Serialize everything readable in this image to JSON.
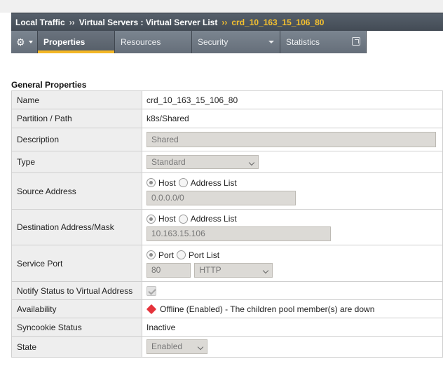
{
  "breadcrumb": {
    "section": "Local Traffic",
    "sep1": "››",
    "path": "Virtual Servers : Virtual Server List",
    "sep2": "››",
    "current": "crd_10_163_15_106_80"
  },
  "tabs": [
    {
      "label": "Properties"
    },
    {
      "label": "Resources"
    },
    {
      "label": "Security"
    },
    {
      "label": "Statistics"
    }
  ],
  "section_title": "General Properties",
  "props": {
    "name": {
      "label": "Name",
      "value": "crd_10_163_15_106_80"
    },
    "partition": {
      "label": "Partition / Path",
      "value": "k8s/Shared"
    },
    "description": {
      "label": "Description",
      "value": "Shared"
    },
    "type": {
      "label": "Type",
      "value": "Standard"
    },
    "source": {
      "label": "Source Address",
      "opt1": "Host",
      "opt2": "Address List",
      "value": "0.0.0.0/0"
    },
    "destination": {
      "label": "Destination Address/Mask",
      "opt1": "Host",
      "opt2": "Address List",
      "value": "10.163.15.106"
    },
    "service_port": {
      "label": "Service Port",
      "opt1": "Port",
      "opt2": "Port List",
      "port": "80",
      "protocol": "HTTP"
    },
    "notify": {
      "label": "Notify Status to Virtual Address"
    },
    "availability": {
      "label": "Availability",
      "value": "Offline (Enabled) - The children pool member(s) are down"
    },
    "syncookie": {
      "label": "Syncookie Status",
      "value": "Inactive"
    },
    "state": {
      "label": "State",
      "value": "Enabled"
    }
  },
  "colors": {
    "accent": "#f4b726",
    "breadcrumb_current": "#f4c02f",
    "offline": "#e5333b"
  },
  "icons": {
    "gear": "gear-icon",
    "popout": "popout-icon",
    "status": "red-diamond-icon"
  }
}
